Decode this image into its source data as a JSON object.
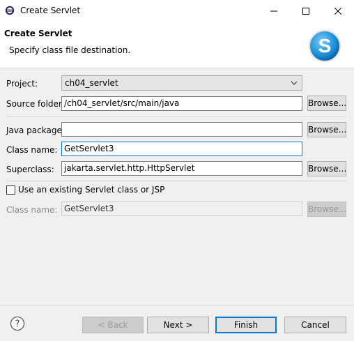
{
  "window": {
    "title": "Create Servlet",
    "app_icon": "eclipse-icon",
    "minimize_icon": "minimize-icon",
    "maximize_icon": "maximize-icon",
    "close_icon": "close-icon"
  },
  "banner": {
    "title": "Create Servlet",
    "description": "Specify class file destination.",
    "logo_icon": "servlet-s-logo-icon",
    "logo_letter": "S"
  },
  "form": {
    "project": {
      "label": "Project:",
      "value": "ch04_servlet"
    },
    "source_folder": {
      "label": "Source folder:",
      "value": "/ch04_servlet/src/main/java",
      "browse": "Browse..."
    },
    "java_package": {
      "label": "Java package:",
      "value": "",
      "browse": "Browse..."
    },
    "class_name": {
      "label": "Class name:",
      "value": "GetServlet3"
    },
    "superclass": {
      "label": "Superclass:",
      "value": "jakarta.servlet.http.HttpServlet",
      "browse": "Browse..."
    },
    "use_existing": {
      "label": "Use an existing Servlet class or JSP",
      "checked": false
    },
    "existing_class_name": {
      "label": "Class name:",
      "value": "GetServlet3",
      "browse": "Browse..."
    }
  },
  "buttons": {
    "help_icon": "help-icon",
    "back": "< Back",
    "next": "Next >",
    "finish": "Finish",
    "cancel": "Cancel"
  },
  "colors": {
    "focus_blue": "#0078d7",
    "logo_blue": "#1a8fd8"
  }
}
